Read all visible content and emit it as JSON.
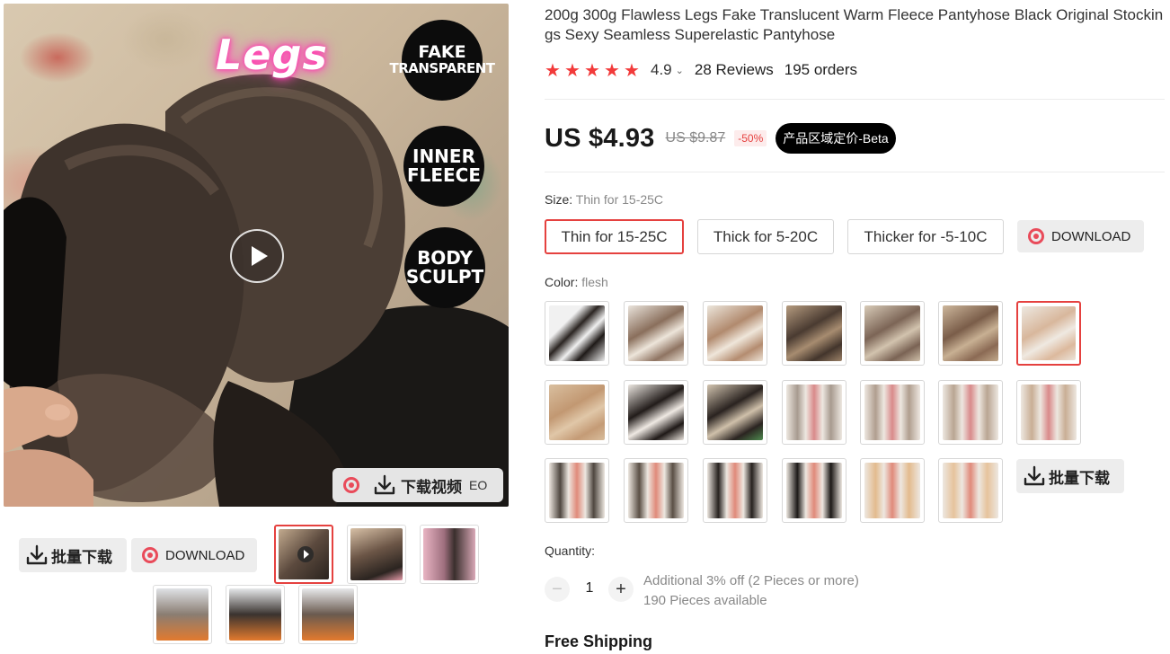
{
  "gallery": {
    "main_image": {
      "headline": "Legs",
      "badges": [
        {
          "line1": "FAKE",
          "line2": "TRANSPARENT"
        },
        {
          "line1": "INNER",
          "line2": "FLEECE"
        },
        {
          "line1": "BODY",
          "line2": "SCULPT"
        }
      ],
      "video_download_label": "下载视频",
      "video_suffix": "EO"
    },
    "batch_download_label": "批量下载",
    "download_label": "DOWNLOAD"
  },
  "product": {
    "title": "200g 300g Flawless Legs Fake Translucent Warm Fleece Pantyhose Black Original Stockings Sexy Seamless Superelastic Pantyhose",
    "rating": "4.9",
    "reviews": "28 Reviews",
    "orders": "195 orders",
    "price": "US $4.93",
    "original_price": "US $9.87",
    "discount": "-50%",
    "region_tag": "产品区域定价-Beta"
  },
  "size": {
    "label": "Size: ",
    "selected": "Thin for 15-25C",
    "options": [
      "Thin for 15-25C",
      "Thick for 5-20C",
      "Thicker for -5-10C"
    ],
    "download_label": "DOWNLOAD"
  },
  "color": {
    "label": "Color: ",
    "selected": "flesh",
    "batch_download_label": "批量下载"
  },
  "quantity": {
    "label": "Quantity:",
    "value": "1",
    "discount_note": "Additional 3% off (2 Pieces or more)",
    "available": "190 Pieces available"
  },
  "shipping": {
    "label": "Free Shipping"
  },
  "icons": {
    "star": "star-icon",
    "download": "download-icon",
    "target": "target-icon",
    "play": "play-icon"
  },
  "colors": {
    "accent": "#e5413f",
    "star": "#f23a3a",
    "badge_bg": "#000000"
  }
}
